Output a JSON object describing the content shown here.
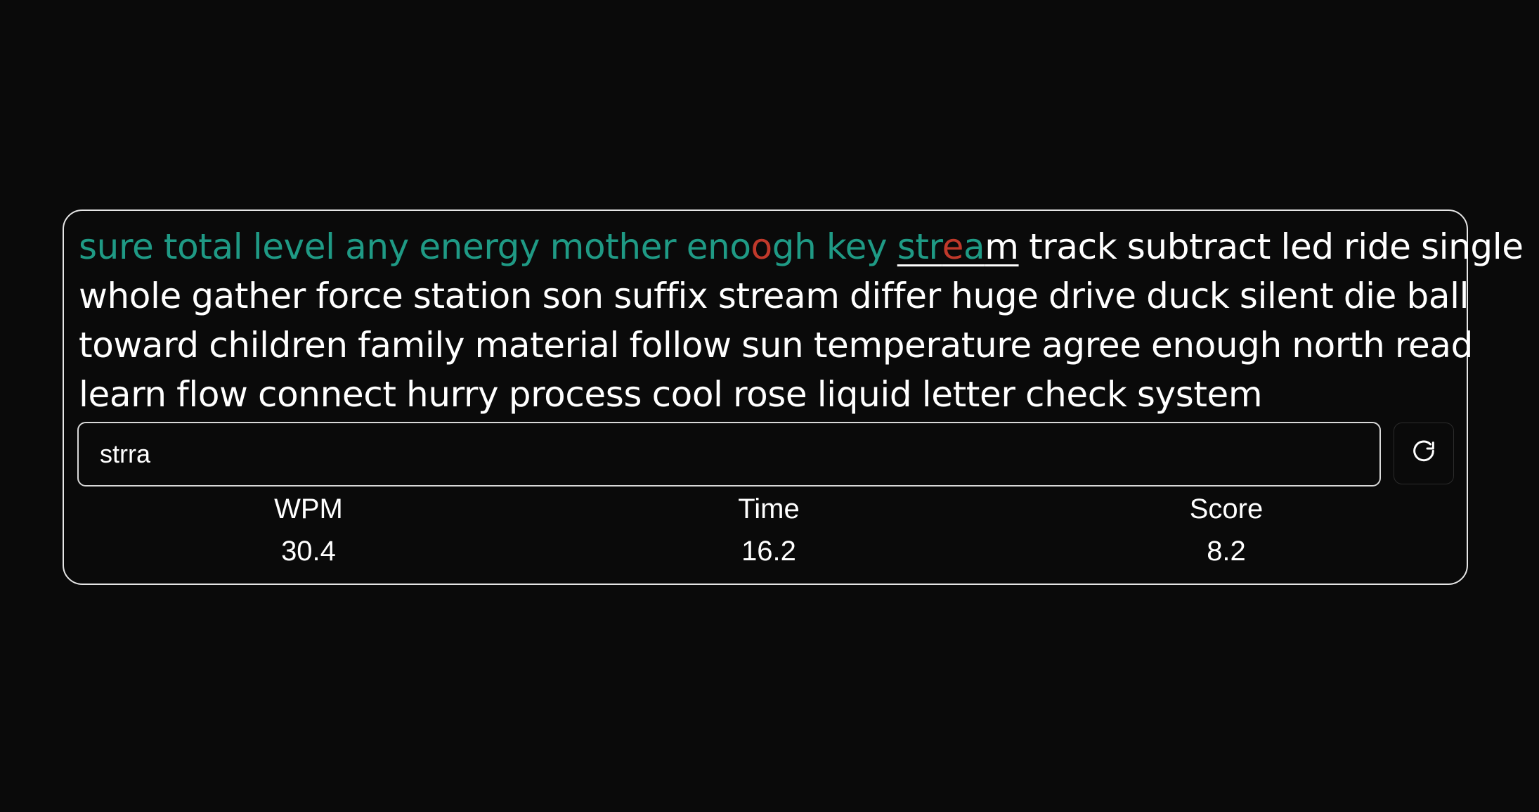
{
  "prompt": {
    "typed_words": [
      "sure",
      "total",
      "level",
      "any",
      "energy",
      "mother"
    ],
    "enough_parts": [
      "eno",
      "o",
      "gh"
    ],
    "after_enough": "key",
    "current_word": {
      "correct_prefix": "str",
      "wrong": "e",
      "correct_after": "a",
      "remaining": "m"
    },
    "line1_rest": "track subtract led ride single",
    "line2": "whole gather force station son suffix stream differ huge drive duck silent die ball",
    "line3": "toward children family material follow sun temperature agree enough north read",
    "line4": "learn flow connect hurry process cool rose liquid letter check system"
  },
  "input": {
    "value": "strra"
  },
  "reset_button": {
    "icon": "refresh-icon"
  },
  "stats": {
    "wpm_label": "WPM",
    "wpm_value": "30.4",
    "time_label": "Time",
    "time_value": "16.2",
    "score_label": "Score",
    "score_value": "8.2"
  },
  "colors": {
    "background": "#0a0a0a",
    "correct": "#1f9a85",
    "error": "#c0392b",
    "text": "#ffffff",
    "border": "#e6e6e6"
  }
}
